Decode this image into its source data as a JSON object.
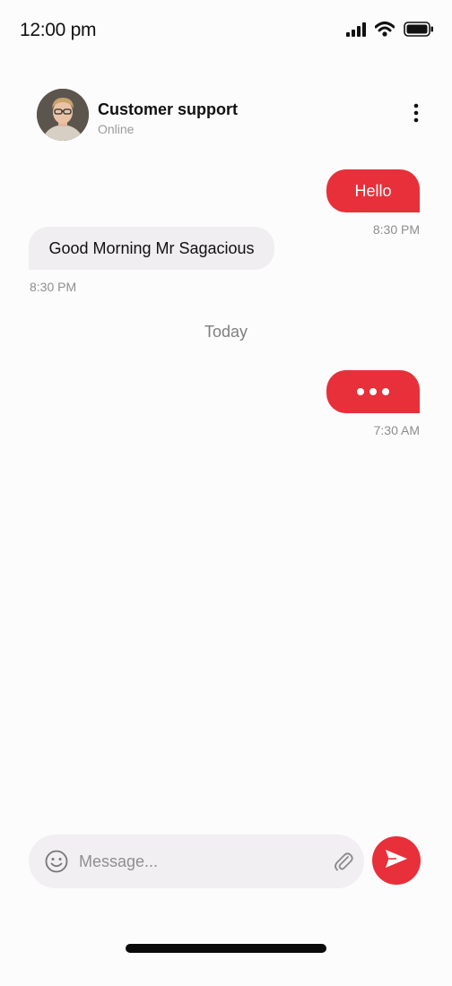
{
  "status_bar": {
    "time": "12:00 pm",
    "icons": [
      "cellular-signal-icon",
      "wifi-icon",
      "battery-icon"
    ]
  },
  "header": {
    "contact_name": "Customer support",
    "contact_status": "Online",
    "menu_icon": "more-vertical-icon"
  },
  "messages": [
    {
      "direction": "outgoing",
      "text": "Hello",
      "time": "8:30 PM"
    },
    {
      "direction": "incoming",
      "text": "Good Morning Mr Sagacious",
      "time": "8:30 PM"
    },
    {
      "direction": "outgoing",
      "typing": true,
      "time": "7:30 AM"
    }
  ],
  "day_separator": "Today",
  "composer": {
    "placeholder": "Message...",
    "emoji_icon": "emoji-icon",
    "attach_icon": "paperclip-icon",
    "send_icon": "send-icon"
  },
  "colors": {
    "accent": "#e7303a",
    "incoming_bubble": "#f0eef0",
    "muted_text": "#8e8e8e"
  }
}
